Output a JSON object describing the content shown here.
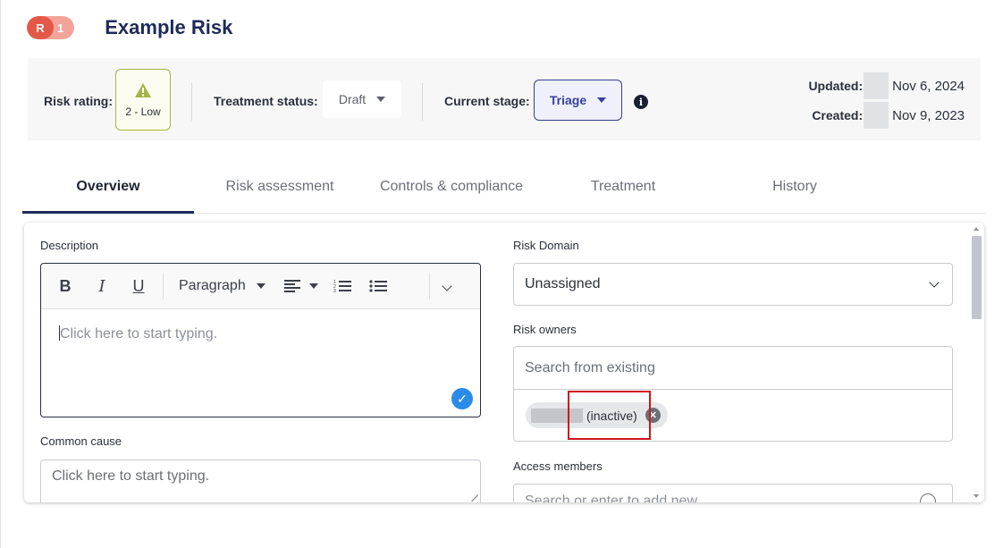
{
  "header": {
    "badge_prefix": "R",
    "badge_number": "1",
    "title": "Example Risk"
  },
  "status_bar": {
    "risk_rating_label": "Risk rating:",
    "risk_rating_value": "2 - Low",
    "risk_rating_color": "#a7b44a",
    "treatment_status_label": "Treatment status:",
    "treatment_status_value": "Draft",
    "current_stage_label": "Current stage:",
    "current_stage_value": "Triage",
    "updated_label": "Updated:",
    "updated_value": "Nov 6, 2024",
    "created_label": "Created:",
    "created_value": "Nov 9, 2023"
  },
  "tabs": [
    {
      "label": "Overview",
      "active": true
    },
    {
      "label": "Risk assessment",
      "active": false
    },
    {
      "label": "Controls & compliance",
      "active": false
    },
    {
      "label": "Treatment",
      "active": false
    },
    {
      "label": "History",
      "active": false
    }
  ],
  "form": {
    "description_label": "Description",
    "toolbar": {
      "bold": "B",
      "italic": "I",
      "underline": "U",
      "paragraph": "Paragraph"
    },
    "description_placeholder": "Click here to start typing.",
    "common_cause_label": "Common cause",
    "common_cause_placeholder": "Click here to start typing.",
    "risk_domain_label": "Risk Domain",
    "risk_domain_value": "Unassigned",
    "risk_owners_label": "Risk owners",
    "risk_owners_placeholder": "Search from existing",
    "owner_chip_status": "(inactive)",
    "access_members_label": "Access members",
    "access_members_placeholder": "Search or enter to add new"
  },
  "colors": {
    "brand_navy": "#1e2a5a",
    "badge_red": "#e4584a",
    "stage_accent": "#3a3f9f",
    "highlight_red": "#d0151b",
    "check_blue": "#2b8be8"
  }
}
